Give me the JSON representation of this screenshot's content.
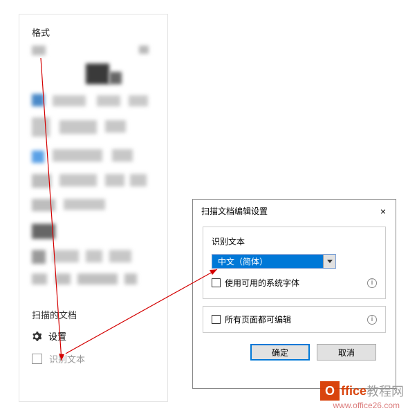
{
  "panel": {
    "title": "格式",
    "scanned_docs_label": "扫描的文档",
    "settings_label": "设置",
    "recognize_text_label": "识别文本"
  },
  "dialog": {
    "title": "扫描文档编辑设置",
    "close": "×",
    "section_recognize": "识别文本",
    "language_selected": "中文（简体）",
    "use_system_fonts": "使用可用的系统字体",
    "all_pages_editable": "所有页面都可编辑",
    "ok": "确定",
    "cancel": "取消"
  },
  "watermark": {
    "brand1": "ffice",
    "brand2": "教程网",
    "icon_letter": "O",
    "url": "www.office26.com"
  }
}
